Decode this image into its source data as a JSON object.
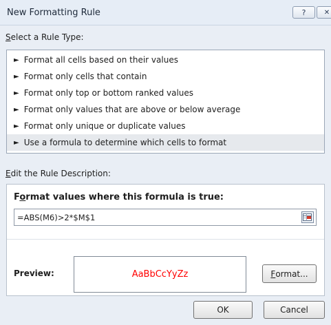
{
  "window": {
    "title": "New Formatting Rule",
    "help_glyph": "?",
    "close_glyph": "✕"
  },
  "rule_type": {
    "label_accel": "S",
    "label_rest": "elect a Rule Type:",
    "items": [
      "Format all cells based on their values",
      "Format only cells that contain",
      "Format only top or bottom ranked values",
      "Format only values that are above or below average",
      "Format only unique or duplicate values",
      "Use a formula to determine which cells to format"
    ],
    "selected_index": 5
  },
  "description": {
    "label_accel": "E",
    "label_rest": "dit the Rule Description:",
    "heading_pre": "F",
    "heading_accel": "o",
    "heading_post": "rmat values where this formula is true:",
    "formula": "=ABS(M6)>2*$M$1"
  },
  "preview": {
    "label": "Preview:",
    "sample": "AaBbCcYyZz",
    "sample_color": "#ff0000"
  },
  "buttons": {
    "format_accel": "F",
    "format_rest": "ormat...",
    "ok": "OK",
    "cancel": "Cancel"
  }
}
